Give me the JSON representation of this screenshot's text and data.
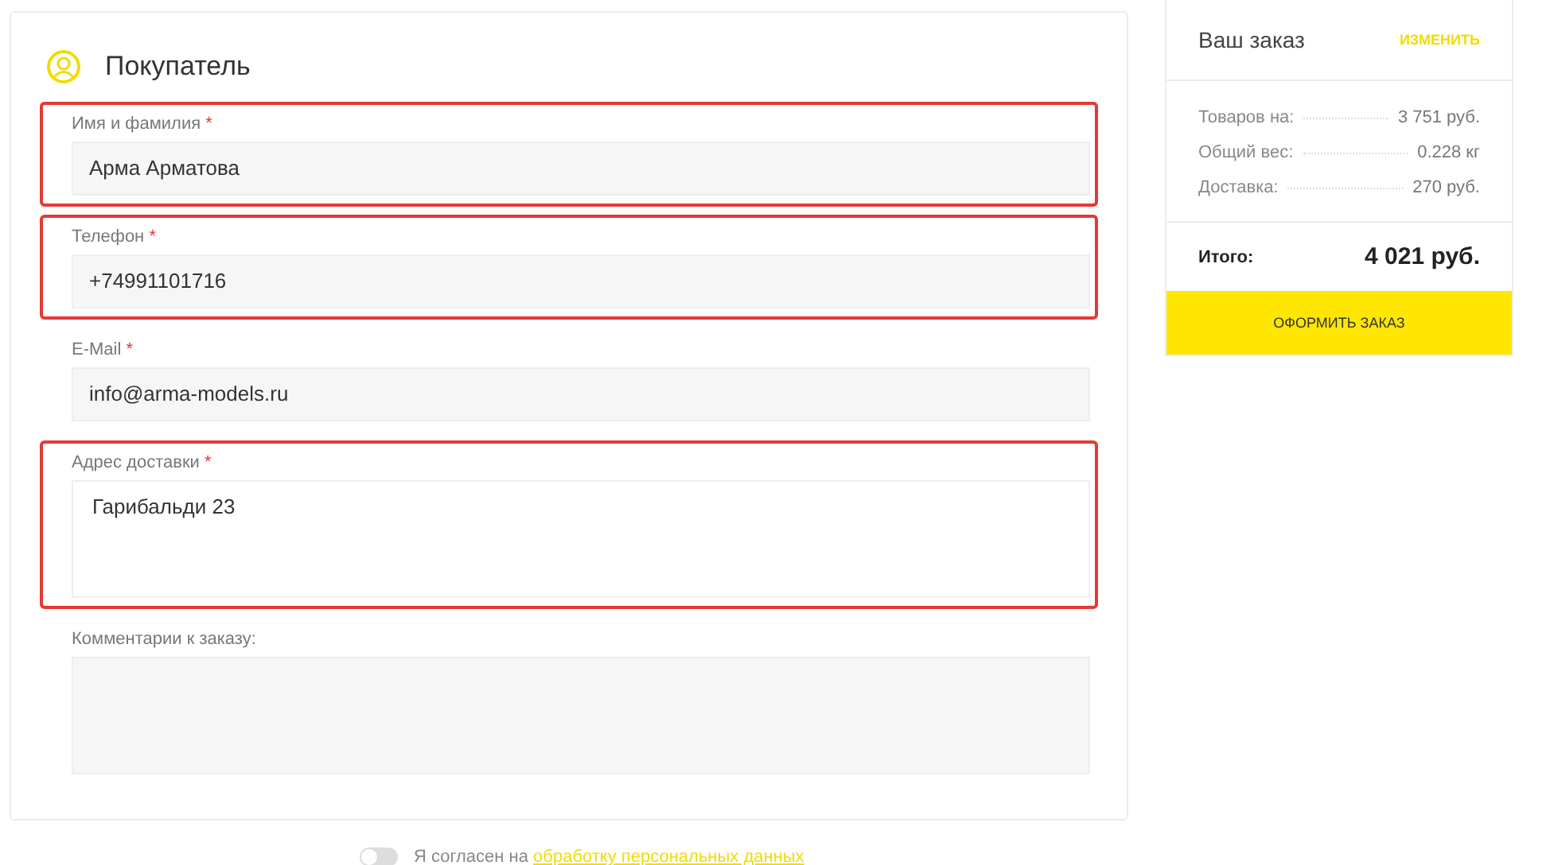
{
  "buyer": {
    "title": "Покупатель",
    "fields": [
      {
        "kind": "input",
        "label": "Имя и фамилия",
        "required_mark": "*",
        "value": "Арма Арматова",
        "highlighted": true
      },
      {
        "kind": "input",
        "label": "Телефон",
        "required_mark": "*",
        "value": "+74991101716",
        "highlighted": true
      },
      {
        "kind": "input",
        "label": "E-Mail",
        "required_mark": "*",
        "value": "info@arma-models.ru",
        "highlighted": false
      },
      {
        "kind": "address",
        "label": "Адрес доставки",
        "required_mark": "*",
        "value": "Гарибальди 23",
        "highlighted": true
      },
      {
        "kind": "comment",
        "label": "Комментарии к заказу:",
        "highlighted": false
      }
    ]
  },
  "consent": {
    "on": false,
    "text": "Я согласен на",
    "link": "обработку персональных данных"
  },
  "order": {
    "title": "Ваш заказ",
    "edit_link": "ИЗМЕНИТЬ",
    "rows": [
      {
        "label": "Товаров на:",
        "value": "3 751 руб."
      },
      {
        "label": "Общий вес:",
        "value": "0.228 кг"
      },
      {
        "label": "Доставка:",
        "value": "270 руб."
      }
    ],
    "total_label": "Итого:",
    "total_value": "4 021 руб.",
    "submit": "ОФОРМИТЬ ЗАКАЗ"
  }
}
